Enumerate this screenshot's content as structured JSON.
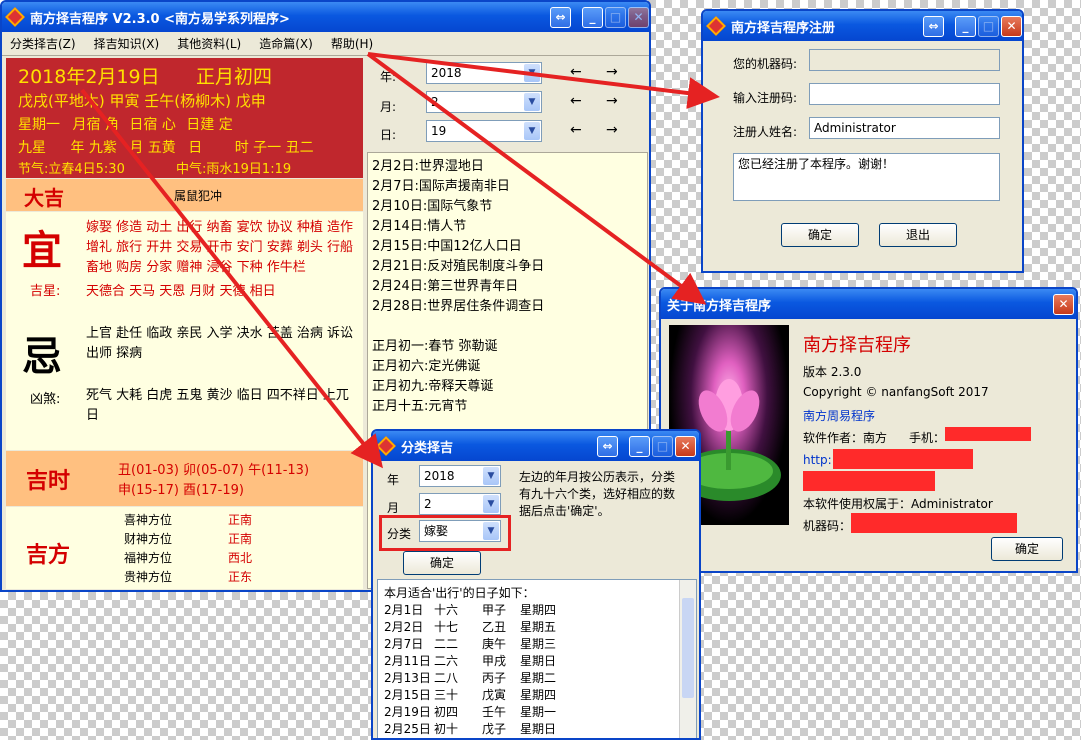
{
  "main_window": {
    "title": "南方择吉程序  V2.3.0   <南方易学系列程序>",
    "menu": [
      "分类择吉(Z)",
      "择吉知识(X)",
      "其他资料(L)",
      "造命篇(X)",
      "帮助(H)"
    ],
    "date_header": {
      "solar": "2018年2月19日",
      "lunar": "正月初四",
      "ganzhi": "戊戌(平地木)  甲寅  壬午(杨柳木)  戊申",
      "week": "星期一",
      "month_lodge": "月宿",
      "month_lodge_val": "角",
      "day_lodge": "日宿",
      "day_lodge_val": "心",
      "day_jian": "日建",
      "day_jian_val": "定",
      "star_label": "九星",
      "year_label": "年",
      "year_star": "九紫",
      "month_label": "月",
      "month_star": "五黄",
      "day_label": "日",
      "hour_label": "时",
      "hour_star": "子一 丑二",
      "jieqi": "节气:立春4日5:30",
      "zhongqi": "中气:雨水19日1:19"
    },
    "fortune": "大吉",
    "clash": "属鼠犯冲",
    "yi_char": "宜",
    "yi_items": "嫁娶 修造 动土 出行 纳畜 宴饮 协议 种植 造作 增礼 旅行 开井 交易 开市 安门 安葬 剃头 行船 畜地 购房 分家 赠神 浸谷 下种 作牛栏",
    "jixing_label": "吉星:",
    "jixing_items": "天德合 天马 天恩 月财 天德 相日",
    "ji_char": "忌",
    "ji_items": "上官 赴任 临政 亲民 入学 决水 苫盖 治病 诉讼 出师 探病",
    "xiongsha_label": "凶煞:",
    "xiongsha_items": "死气 大耗 白虎 五鬼 黄沙 临日 四不祥日 上兀日",
    "jishi_title": "吉时",
    "jishi_line1": "丑(01-03) 卯(05-07) 午(11-13)",
    "jishi_line2": "申(15-17) 酉(17-19)",
    "jifang_title": "吉方",
    "jifang": [
      {
        "label": "喜神方位",
        "dir": "正南"
      },
      {
        "label": "财神方位",
        "dir": "正南"
      },
      {
        "label": "福神方位",
        "dir": "西北"
      },
      {
        "label": "贵神方位",
        "dir": "正东"
      }
    ],
    "year_label": "年:",
    "year_val": "2018",
    "month_label": "月:",
    "month_val": "2",
    "day_label": "日:",
    "day_val": "19",
    "arrow_left": "←",
    "arrow_right": "→",
    "festivals": [
      "2月2日:世界湿地日",
      "2月7日:国际声援南非日",
      "2月10日:国际气象节",
      "2月14日:情人节",
      "2月15日:中国12亿人口日",
      "2月21日:反对殖民制度斗争日",
      "2月24日:第三世界青年日",
      "2月28日:世界居住条件调查日",
      "",
      "正月初一:春节 弥勒诞",
      "正月初六:定光佛诞",
      "正月初九:帝释天尊诞",
      "正月十五:元宵节"
    ]
  },
  "register_window": {
    "title": "南方择吉程序注册",
    "machine_label": "您的机器码:",
    "machine_val": "",
    "code_label": "输入注册码:",
    "code_val": "",
    "name_label": "注册人姓名:",
    "name_val": "Administrator",
    "message": "您已经注册了本程序。谢谢！",
    "ok": "确定",
    "exit": "退出"
  },
  "about_window": {
    "title": "关于南方择吉程序",
    "app_name": "南方择吉程序",
    "version": "版本 2.3.0",
    "copyright": "Copyright © nanfangSoft 2017",
    "link": "南方周易程序",
    "author_label": "软件作者：南方",
    "phone_label": "手机：",
    "url_prefix": "http:",
    "owner": "本软件使用权属于：Administrator",
    "machine_label": "机器码：",
    "ok": "确定"
  },
  "classify_window": {
    "title": "分类择吉",
    "year_label": "年",
    "year_val": "2018",
    "month_label": "月",
    "month_val": "2",
    "cat_label": "分类",
    "cat_val": "嫁娶",
    "ok": "确定",
    "help": "左边的年月按公历表示，分类有九十六个类，选好相应的数据后点击'确定'。",
    "result_title": "本月适合'出行'的日子如下：",
    "results": [
      [
        "2月1日",
        "十六",
        "甲子",
        "星期四"
      ],
      [
        "2月2日",
        "十七",
        "乙丑",
        "星期五"
      ],
      [
        "2月7日",
        "二二",
        "庚午",
        "星期三"
      ],
      [
        "2月11日",
        "二六",
        "甲戌",
        "星期日"
      ],
      [
        "2月13日",
        "二八",
        "丙子",
        "星期二"
      ],
      [
        "2月15日",
        "三十",
        "戊寅",
        "星期四"
      ],
      [
        "2月19日",
        "初四",
        "壬午",
        "星期一"
      ],
      [
        "2月25日",
        "初十",
        "戊子",
        "星期日"
      ]
    ]
  },
  "colors": {
    "titlebar": "#0a58e0",
    "header_red": "#c0272d",
    "orange": "#ffc080",
    "cream": "#ffffe1",
    "annotation_red": "#e52222"
  }
}
